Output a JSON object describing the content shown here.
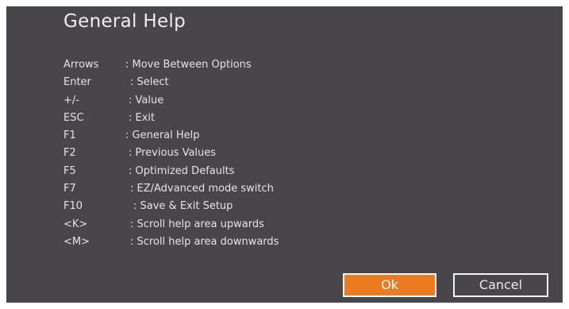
{
  "dialog": {
    "title": "General Help",
    "bindings": [
      {
        "key": "Arrows",
        "desc": ": Move Between Options"
      },
      {
        "key": "Enter",
        "desc": ": Select"
      },
      {
        "key": "+/-",
        "desc": ": Value"
      },
      {
        "key": "ESC",
        "desc": ": Exit"
      },
      {
        "key": "F1",
        "desc": ": General Help"
      },
      {
        "key": "F2",
        "desc": ": Previous Values"
      },
      {
        "key": "F5",
        "desc": ": Optimized Defaults"
      },
      {
        "key": "F7",
        "desc": ": EZ/Advanced mode switch"
      },
      {
        "key": "F10",
        "desc": ": Save & Exit Setup"
      },
      {
        "key": "<K>",
        "desc": ": Scroll help area upwards"
      },
      {
        "key": "<M>",
        "desc": ": Scroll help area downwards"
      }
    ],
    "buttons": {
      "ok_label": "Ok",
      "cancel_label": "Cancel"
    }
  },
  "colors": {
    "background": "#48464a",
    "accent": "#ea7b21",
    "text": "#e4e2e6"
  }
}
